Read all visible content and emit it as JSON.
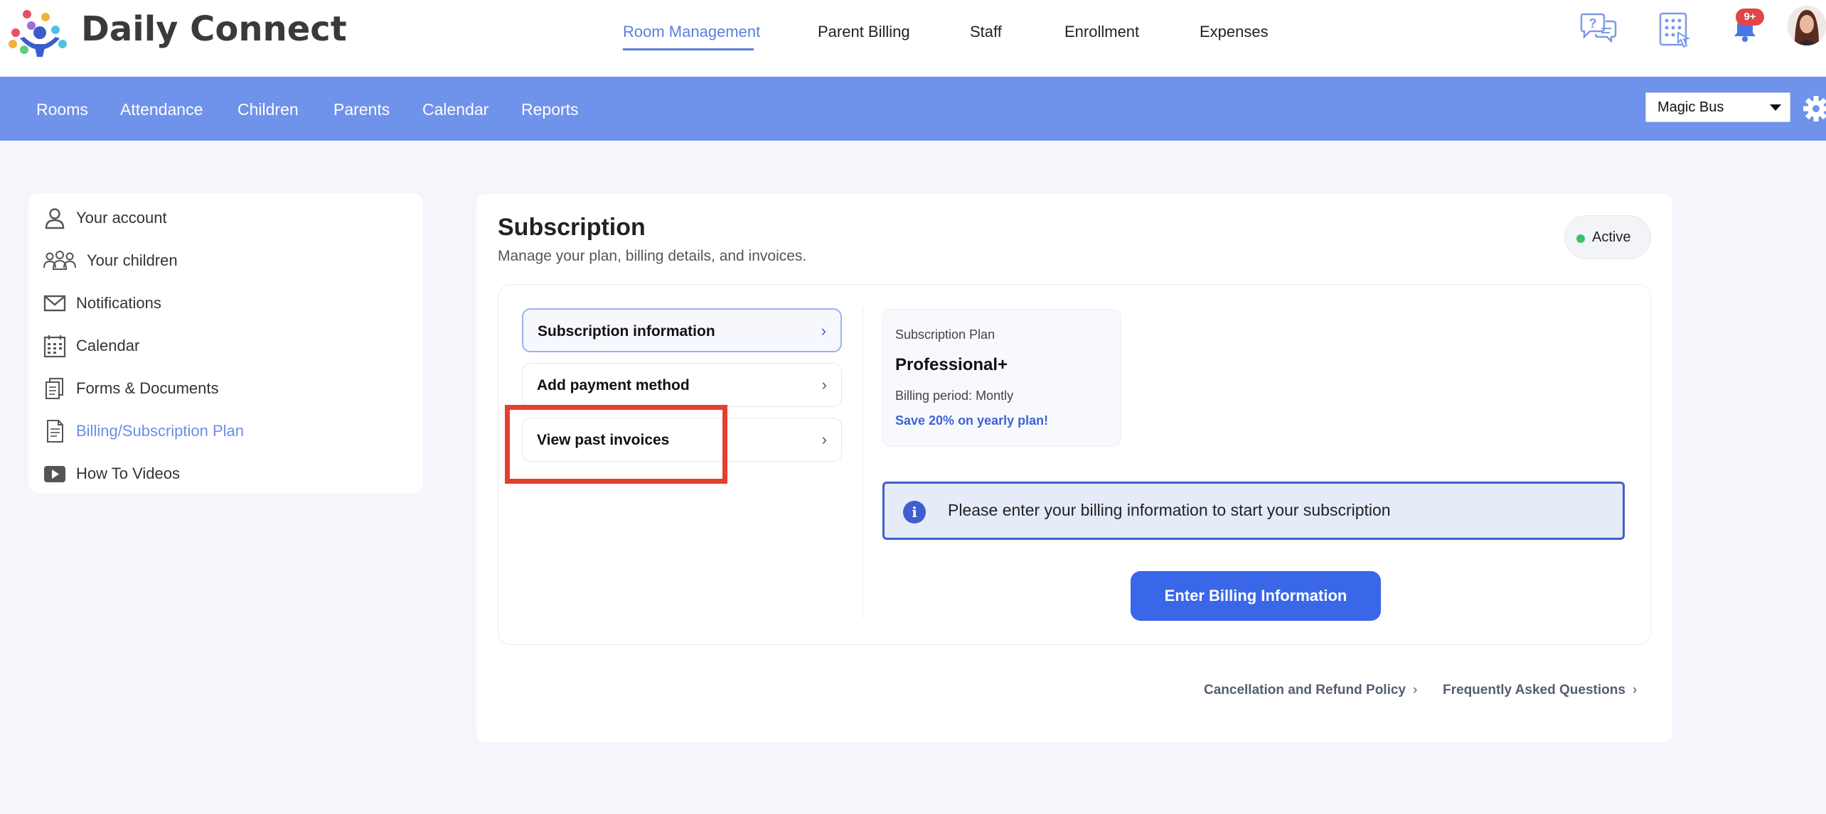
{
  "app": {
    "name": "Daily Connect"
  },
  "main_nav": [
    {
      "label": "Room Management",
      "active": true
    },
    {
      "label": "Parent Billing",
      "active": false
    },
    {
      "label": "Staff",
      "active": false
    },
    {
      "label": "Enrollment",
      "active": false
    },
    {
      "label": "Expenses",
      "active": false
    }
  ],
  "header_icons": {
    "help": "chat-help-icon",
    "keypad": "keypad-icon",
    "notifications": "bell-icon",
    "notification_badge": "9+",
    "avatar": "user-avatar"
  },
  "sub_nav": [
    {
      "label": "Rooms"
    },
    {
      "label": "Attendance"
    },
    {
      "label": "Children"
    },
    {
      "label": "Parents"
    },
    {
      "label": "Calendar"
    },
    {
      "label": "Reports"
    }
  ],
  "school_select": {
    "value": "Magic Bus"
  },
  "sidebar": {
    "items": [
      {
        "label": "Your account",
        "icon": "person-icon",
        "active": false
      },
      {
        "label": "Your children",
        "icon": "children-icon",
        "active": false
      },
      {
        "label": "Notifications",
        "icon": "envelope-icon",
        "active": false
      },
      {
        "label": "Calendar",
        "icon": "calendar-icon",
        "active": false
      },
      {
        "label": "Forms & Documents",
        "icon": "documents-icon",
        "active": false
      },
      {
        "label": "Billing/Subscription Plan",
        "icon": "invoice-icon",
        "active": true
      },
      {
        "label": "How To Videos",
        "icon": "video-icon",
        "active": false
      }
    ]
  },
  "subscription": {
    "title": "Subscription",
    "subtitle": "Manage your plan, billing details, and invoices.",
    "status": "Active",
    "menu": [
      {
        "label": "Subscription information",
        "selected": true
      },
      {
        "label": "Add payment method",
        "selected": false
      },
      {
        "label": "View past invoices",
        "selected": false
      }
    ],
    "plan": {
      "caption": "Subscription Plan",
      "name": "Professional+",
      "billing_period": "Billing period:  Montly",
      "promo": "Save 20% on yearly plan!"
    },
    "info_message": "Please enter your billing information to start your subscription",
    "primary_button": "Enter Billing Information",
    "footer_links": [
      {
        "label": "Cancellation and Refund Policy"
      },
      {
        "label": "Frequently Asked Questions"
      }
    ]
  },
  "colors": {
    "accent": "#6f92ea",
    "primary_button": "#3a67e8",
    "highlight": "#e3402e",
    "status_dot": "#3cc06a"
  }
}
